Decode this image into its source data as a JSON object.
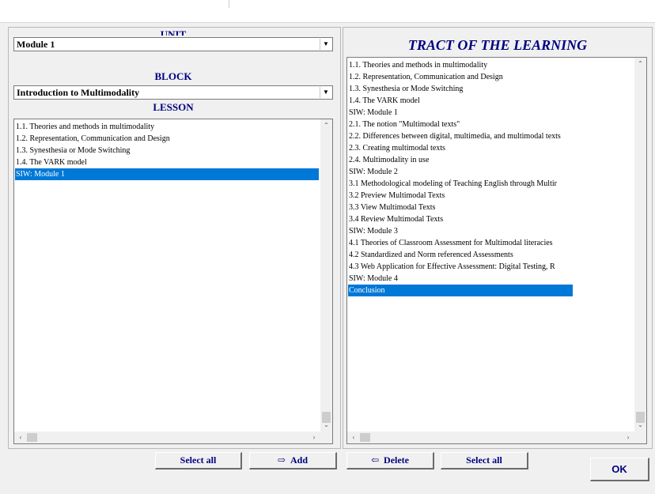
{
  "left": {
    "unit": {
      "heading": "UNIT",
      "value": "Module 1"
    },
    "block": {
      "heading": "BLOCK",
      "value": "Introduction to Multimodality"
    },
    "lesson": {
      "heading": "LESSON",
      "items": [
        "1.1. Theories and methods in multimodality",
        "1.2. Representation, Communication and Design",
        "1.3. Synesthesia or Mode Switching",
        "1.4. The VARK model",
        "SIW: Module 1"
      ],
      "selected": "SIW: Module 1"
    }
  },
  "right": {
    "heading": "TRACT OF THE LEARNING",
    "items": [
      "1.1. Theories and methods in multimodality",
      "1.2. Representation, Communication and Design",
      "1.3. Synesthesia or Mode Switching",
      "1.4. The VARK model",
      "SIW: Module 1",
      "2.1. The notion \"Multimodal texts\"",
      "2.2. Differences between digital, multimedia, and multimodal texts",
      "2.3. Creating multimodal texts",
      "2.4. Multimodality in use",
      "SIW: Module 2",
      "3.1 Methodological modeling of Teaching English through Multir",
      "3.2 Preview Multimodal Texts",
      "3.3 View Multimodal Texts",
      "3.4 Review Multimodal Texts",
      "SIW: Module 3",
      "4.1 Theories of Classroom Assessment for Multimodal literacies",
      "4.2 Standardized and Norm referenced Assessments",
      "4.3 Web Application for Effective Assessment: Digital Testing, R",
      "SIW: Module 4",
      "Conclusion"
    ],
    "selected": "Conclusion"
  },
  "buttons": {
    "select_all_left": "Select all",
    "add": "Add",
    "delete": "Delete",
    "select_all_right": "Select all",
    "ok": "OK"
  },
  "icons": {
    "add": "arrow-right-icon",
    "delete": "arrow-left-icon",
    "combo_arrow": "chevron-down-icon"
  },
  "colors": {
    "heading": "#000080",
    "selection": "#0078d7",
    "background": "#f0f0f0"
  }
}
